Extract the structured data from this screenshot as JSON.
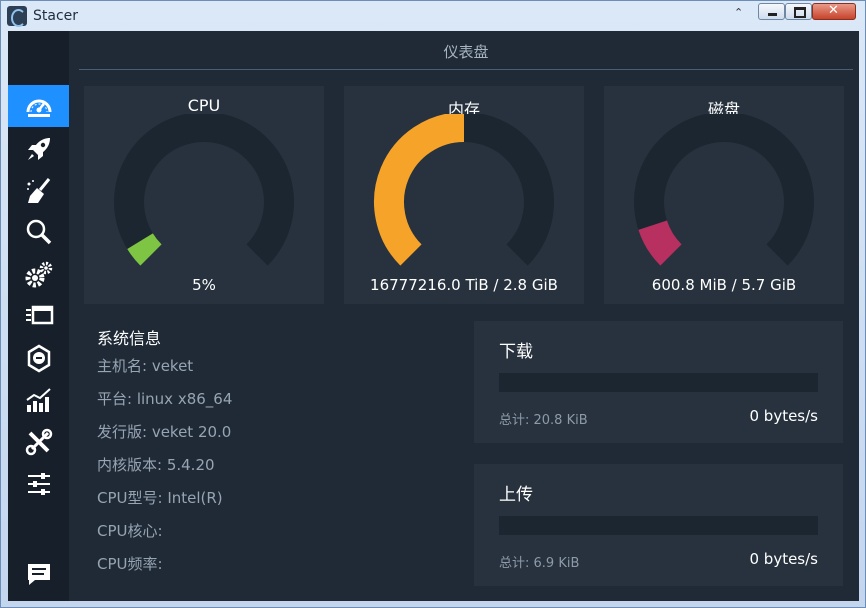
{
  "window": {
    "title": "Stacer",
    "chevron": "⌃"
  },
  "sidebar": {
    "items": [
      {
        "icon": "dashboard-icon",
        "active": true
      },
      {
        "icon": "rocket-icon",
        "active": false
      },
      {
        "icon": "broom-icon",
        "active": false
      },
      {
        "icon": "search-icon",
        "active": false
      },
      {
        "icon": "gears-icon",
        "active": false
      },
      {
        "icon": "processes-icon",
        "active": false
      },
      {
        "icon": "uninstaller-icon",
        "active": false
      },
      {
        "icon": "resources-chart-icon",
        "active": false
      },
      {
        "icon": "tools-icon",
        "active": false
      },
      {
        "icon": "settings-sliders-icon",
        "active": false
      }
    ],
    "feedback_icon": "feedback-icon"
  },
  "page": {
    "title": "仪表盘"
  },
  "gauges": [
    {
      "title": "CPU",
      "value": "5%",
      "percent": 5,
      "color": "#7dc542"
    },
    {
      "title": "内存",
      "value": "16777216.0 TiB / 2.8 GiB",
      "percent": 50,
      "color": "#f5a329"
    },
    {
      "title": "磁盘",
      "value": "600.8 MiB / 5.7 GiB",
      "percent": 10,
      "color": "#b7305f"
    }
  ],
  "system_info": {
    "title": "系统信息",
    "rows": [
      "主机名: veket",
      "平台: linux x86_64",
      "发行版: veket 20.0",
      "内核版本: 5.4.20",
      "CPU型号: Intel(R)",
      "CPU核心:",
      "CPU频率:"
    ]
  },
  "network": {
    "download": {
      "title": "下载",
      "total": "总计: 20.8 KiB",
      "speed": "0 bytes/s"
    },
    "upload": {
      "title": "上传",
      "total": "总计: 6.9 KiB",
      "speed": "0 bytes/s"
    }
  },
  "colors": {
    "accent": "#1e90ff",
    "background": "#1f2a36",
    "card": "#27323e",
    "sidebar": "#17202a"
  }
}
